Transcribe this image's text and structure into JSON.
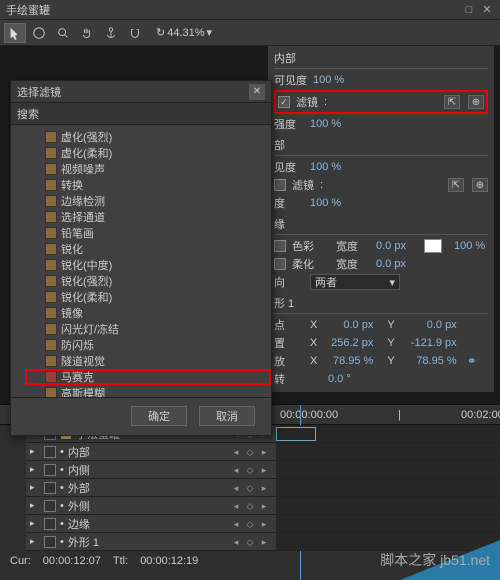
{
  "window": {
    "title": "手绘蜜罐"
  },
  "toolbar": {
    "zoom": "44.31%"
  },
  "props": {
    "section_inner": "内部",
    "visibility_label": "可见度",
    "visibility_val": "100 %",
    "filter_label": "滤镜",
    "filter_sep": ":",
    "intensity_label": "强度",
    "intensity_val": "100 %",
    "section_outer": "部",
    "outer_vis_label": "见度",
    "outer_vis_val": "100 %",
    "outer_filter_label": "滤镜",
    "outer_intensity_label": "度",
    "outer_intensity_val": "100 %",
    "section_edge": "缘",
    "color_label": "色彩",
    "width_label": "宽度",
    "width_val": "0.0 px",
    "opacity_val": "100 %",
    "soft_label": "柔化",
    "soft_width_label": "宽度",
    "soft_width_val": "0.0 px",
    "direction_label": "向",
    "direction_val": "两者",
    "section_shape": "形 1",
    "anchor_label": "点",
    "pos_label": "置",
    "scale_label": "放",
    "rot_label": "转",
    "x_label": "X",
    "y_label": "Y",
    "anchor_x": "0.0 px",
    "anchor_y": "0.0 px",
    "pos_x": "256.2 px",
    "pos_y": "-121.9 px",
    "scale_x": "78.95 %",
    "scale_y": "78.95 %",
    "rot_val": "0.0 °"
  },
  "modal": {
    "title": "选择滤镜",
    "search_label": "搜索",
    "ok": "确定",
    "cancel": "取消",
    "items": [
      "虚化(强烈)",
      "虚化(柔和)",
      "视频噪声",
      "转换",
      "边缘检测",
      "选择通道",
      "铅笔画",
      "锐化",
      "锐化(中度)",
      "锐化(强烈)",
      "锐化(柔和)",
      "镜像",
      "闪光灯/冻结",
      "防闪烁",
      "隧道视觉",
      "马赛克",
      "高斯模糊"
    ],
    "highlight_index": 15
  },
  "timeline": {
    "ruler": [
      "00:00:00:00",
      "|",
      "00:02:00:00",
      "|"
    ],
    "layers": [
      {
        "name": "手法蜜罐"
      },
      {
        "name": "内部"
      },
      {
        "name": "内侧"
      },
      {
        "name": "外部"
      },
      {
        "name": "外侧"
      },
      {
        "name": "边缘"
      },
      {
        "name": "外形 1"
      }
    ],
    "cur_label": "Cur:",
    "cur_val": "00:00:12:07",
    "ttl_label": "Ttl:",
    "ttl_val": "00:00:12:19"
  },
  "watermark": "脚本之家 jb51.net"
}
